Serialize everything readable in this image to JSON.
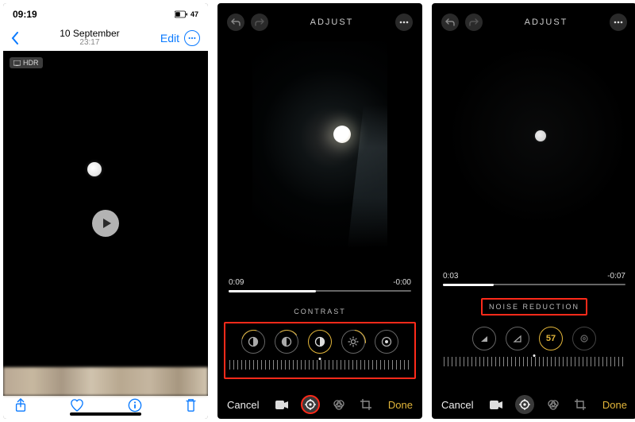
{
  "screen1": {
    "status": {
      "time": "09:19",
      "battery_pct": "47"
    },
    "nav": {
      "edit": "Edit"
    },
    "title": {
      "date": "10 September",
      "time": "23:17"
    },
    "hdr_badge": "HDR",
    "toolbar_icons": [
      "share",
      "favorite",
      "info",
      "delete"
    ]
  },
  "screen2": {
    "header": "ADJUST",
    "trim": {
      "elapsed": "0:09",
      "remaining": "-0:00"
    },
    "adjustment_label": "CONTRAST",
    "knobs": [
      "contrast-left",
      "contrast-mid",
      "contrast",
      "brightness",
      "vignette"
    ],
    "bottom": {
      "cancel": "Cancel",
      "done": "Done"
    },
    "modes": [
      "video",
      "adjust",
      "filters",
      "crop"
    ]
  },
  "screen3": {
    "header": "ADJUST",
    "trim": {
      "elapsed": "0:03",
      "remaining": "-0:07"
    },
    "adjustment_label": "NOISE REDUCTION",
    "value": "57",
    "knobs": [
      "sharpness",
      "definition",
      "noise-reduction-value",
      "vignette-ring"
    ],
    "bottom": {
      "cancel": "Cancel",
      "done": "Done"
    },
    "modes": [
      "video",
      "adjust",
      "filters",
      "crop"
    ]
  },
  "colors": {
    "ios_blue": "#0a7aff",
    "accent_gold": "#e3b63a",
    "highlight_red": "#ff2a1a"
  }
}
